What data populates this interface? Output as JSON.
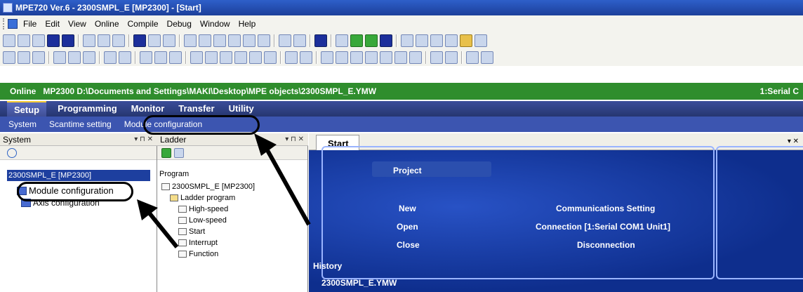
{
  "window": {
    "title": "MPE720 Ver.6 - 2300SMPL_E [MP2300] - [Start]"
  },
  "menu": [
    "File",
    "Edit",
    "View",
    "Online",
    "Compile",
    "Debug",
    "Window",
    "Help"
  ],
  "status": {
    "mode": "Online",
    "path": "MP2300 D:\\Documents and Settings\\MAKI\\Desktop\\MPE objects\\2300SMPL_E.YMW",
    "connection": "1:Serial C"
  },
  "main_tabs": [
    "Setup",
    "Programming",
    "Monitor",
    "Transfer",
    "Utility"
  ],
  "setup_subtabs": [
    "System",
    "Scantime setting",
    "Module configuration"
  ],
  "system_panel": {
    "title": "System",
    "controls": "▾ ⊓ ✕",
    "root": "2300SMPL_E [MP2300]",
    "items": [
      "Module configuration",
      "Axis configuration"
    ]
  },
  "ladder_panel": {
    "title": "Ladder",
    "controls": "▾ ⊓ ✕",
    "program_label": "Program",
    "root": "2300SMPL_E [MP2300]",
    "folder": "Ladder program",
    "items": [
      "High-speed",
      "Low-speed",
      "Start",
      "Interrupt",
      "Function"
    ]
  },
  "start_panel": {
    "tab": "Start",
    "controls": "▾ ✕",
    "project_title": "Project",
    "buttons": [
      "New",
      "Open",
      "Close"
    ],
    "right_buttons": [
      "Communications Setting",
      "Connection [1:Serial COM1 Unit1]",
      "Disconnection"
    ],
    "history_label": "History",
    "history_entry": "2300SMPL_E.YMW"
  }
}
